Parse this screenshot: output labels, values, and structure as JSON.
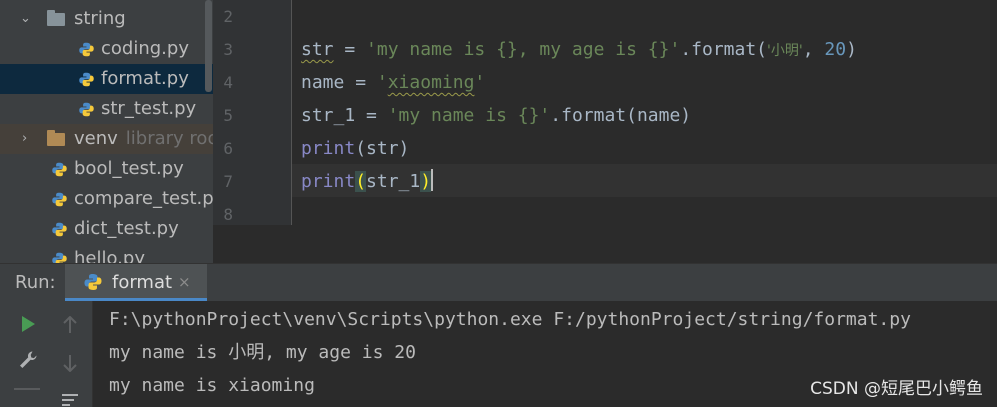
{
  "project_tree": {
    "items": [
      {
        "label": "string",
        "type": "folder",
        "expanded": true
      },
      {
        "label": "coding.py",
        "type": "file"
      },
      {
        "label": "format.py",
        "type": "file",
        "selected": true
      },
      {
        "label": "str_test.py",
        "type": "file"
      },
      {
        "label": "venv",
        "type": "folder",
        "expanded": false,
        "hint": "library roo"
      },
      {
        "label": "bool_test.py",
        "type": "file"
      },
      {
        "label": "compare_test.py",
        "type": "file"
      },
      {
        "label": "dict_test.py",
        "type": "file"
      },
      {
        "label": "hello.py",
        "type": "file"
      }
    ]
  },
  "editor": {
    "line_numbers": [
      "2",
      "3",
      "4",
      "5",
      "6",
      "7",
      "8"
    ],
    "lines": [
      {
        "num": "3",
        "tokens": [
          "str",
          " = ",
          "'my name is {}, my age is {}'",
          ".format(",
          "'小明'",
          ", ",
          "20",
          ")"
        ]
      },
      {
        "num": "4",
        "tokens": [
          "name",
          " = ",
          "'",
          "xiaoming",
          "'"
        ]
      },
      {
        "num": "5",
        "tokens": [
          "str_1",
          " = ",
          "'my name is {}'",
          ".format(name)"
        ]
      },
      {
        "num": "6",
        "tokens": [
          "print",
          "(str)"
        ]
      },
      {
        "num": "7",
        "tokens": [
          "print",
          "(",
          "str_1",
          ")"
        ]
      }
    ]
  },
  "run_panel": {
    "title": "Run:",
    "tab_label": "format",
    "tab_close": "×",
    "console_lines": [
      "F:\\pythonProject\\venv\\Scripts\\python.exe F:/pythonProject/string/format.py",
      "my name is 小明, my age is 20",
      "my name is xiaoming"
    ]
  },
  "watermark": "CSDN @短尾巴小鳄鱼",
  "colors": {
    "sidebar_bg": "#3c3f41",
    "editor_bg": "#2b2b2b",
    "string": "#6a8759",
    "number": "#6897bb",
    "builtin": "#8888c6",
    "run_green": "#499c54"
  },
  "icons": {
    "folder": "folder-icon",
    "python_file": "python-file-icon",
    "run": "play-icon",
    "settings": "wrench-icon",
    "up": "arrow-up-icon",
    "down": "arrow-down-icon"
  }
}
